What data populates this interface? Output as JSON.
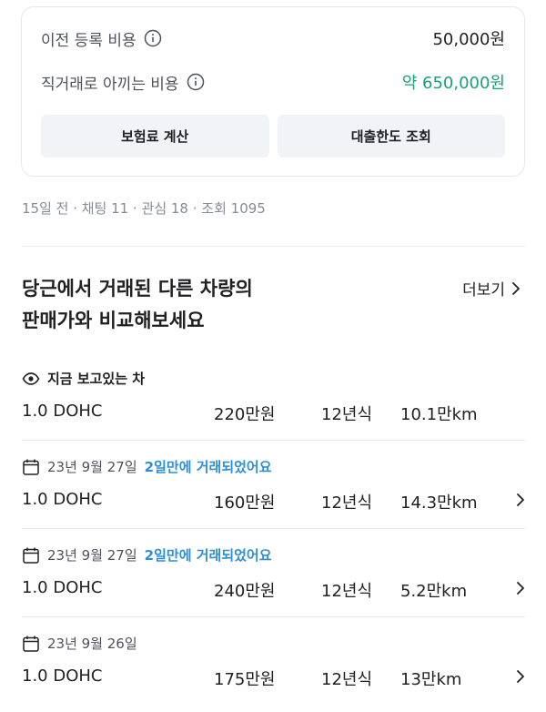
{
  "cost_card": {
    "transfer_fee": {
      "label": "이전 등록 비용",
      "value": "50,000원"
    },
    "direct_savings": {
      "label": "직거래로 아끼는 비용",
      "value": "약 650,000원"
    },
    "insurance_button": "보험료 계산",
    "loan_button": "대출한도 조회"
  },
  "meta": {
    "text": "15일 전 · 채팅 11 · 관심 18 · 조회 1095"
  },
  "compare": {
    "title_line1": "당근에서 거래된 다른 차량의",
    "title_line2": "판매가와 비교해보세요",
    "more_label": "더보기",
    "current": {
      "head": "지금 보고있는 차",
      "model": "1.0 DOHC",
      "price": "220만원",
      "year": "12년식",
      "km": "10.1만km"
    },
    "items": [
      {
        "date": "23년 9월 27일",
        "note": "2일만에 거래되었어요",
        "model": "1.0 DOHC",
        "price": "160만원",
        "year": "12년식",
        "km": "14.3만km"
      },
      {
        "date": "23년 9월 27일",
        "note": "2일만에 거래되었어요",
        "model": "1.0 DOHC",
        "price": "240만원",
        "year": "12년식",
        "km": "5.2만km"
      },
      {
        "date": "23년 9월 26일",
        "note": "",
        "model": "1.0 DOHC",
        "price": "175만원",
        "year": "12년식",
        "km": "13만km"
      }
    ]
  },
  "icons": {
    "info": "info-icon",
    "eye": "eye-icon",
    "calendar": "calendar-icon",
    "chevron": "chevron-right-icon"
  },
  "colors": {
    "savings_green": "#1aa174",
    "accent_blue": "#2e8fd4",
    "muted_text": "#868b94"
  }
}
